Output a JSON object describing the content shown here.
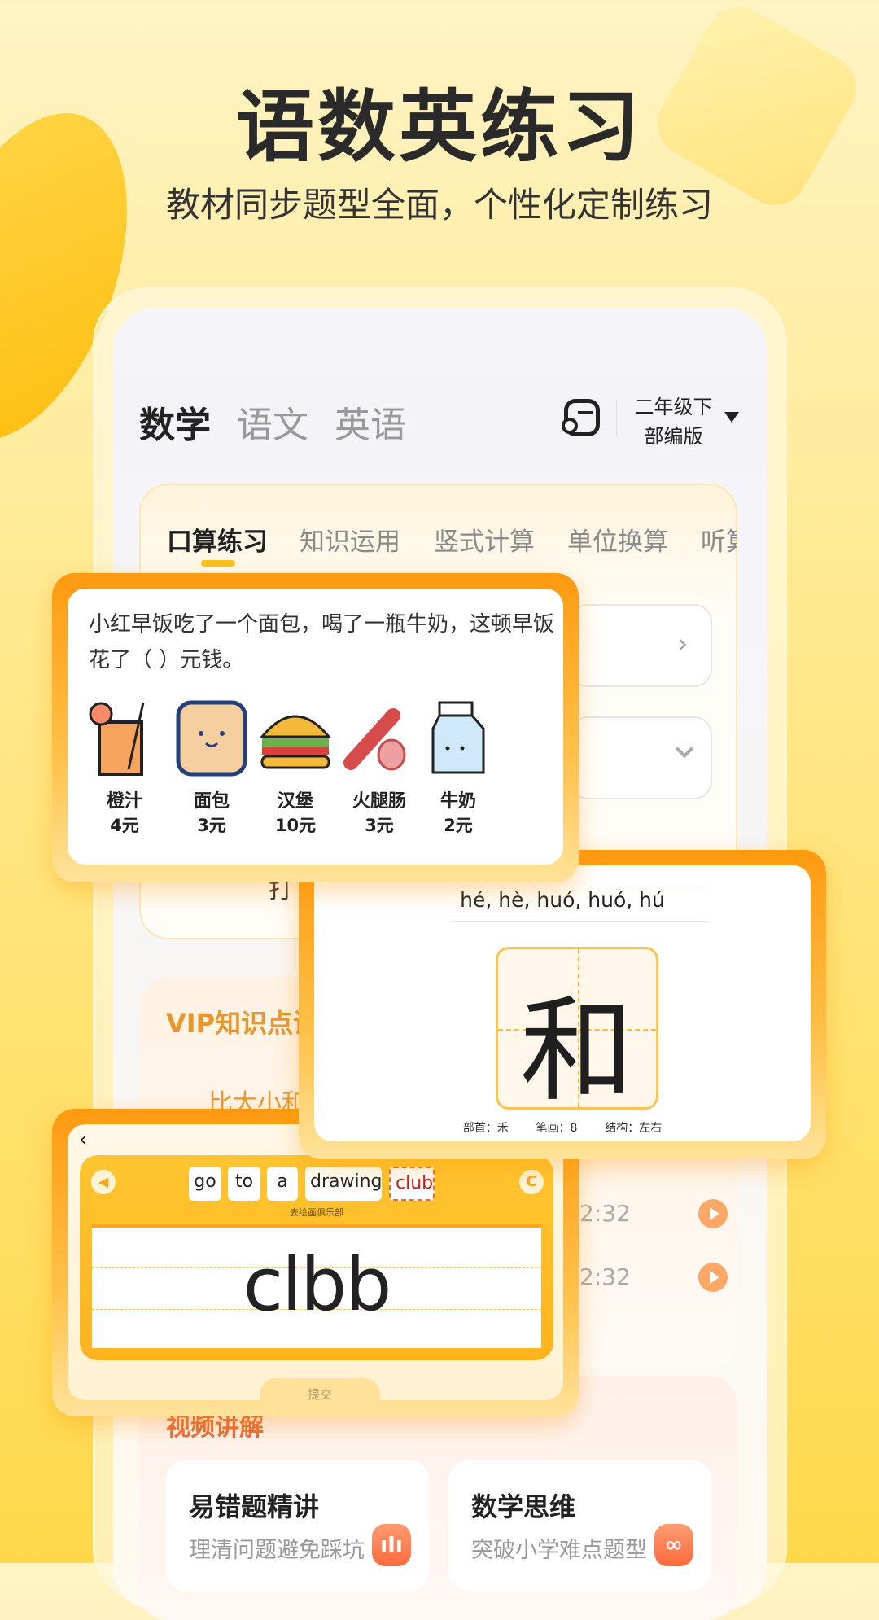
{
  "headline": {
    "title": "语数英练习",
    "subtitle": "教材同步题型全面，个性化定制练习"
  },
  "app": {
    "subjects": [
      {
        "label": "数学",
        "active": true
      },
      {
        "label": "语文",
        "active": false
      },
      {
        "label": "英语",
        "active": false
      }
    ],
    "grade": {
      "line1": "二年级下",
      "line2": "部编版"
    },
    "practice_tabs": [
      {
        "label": "口算练习",
        "active": true
      },
      {
        "label": "知识运用"
      },
      {
        "label": "竖式计算"
      },
      {
        "label": "单位换算"
      },
      {
        "label": "听算"
      }
    ],
    "partial_text": "打",
    "vip": {
      "title": "VIP知识点讲",
      "item": "比大小和",
      "times": [
        "2:32",
        "2:32"
      ]
    },
    "video": {
      "title": "视频讲解",
      "cards": [
        {
          "title": "易错题精讲",
          "subtitle": "理清问题避免踩坑",
          "icon": "audio-wave-icon"
        },
        {
          "title": "数学思维",
          "subtitle": "突破小学难点题型",
          "icon": "infinity-icon"
        }
      ]
    }
  },
  "question_card": {
    "text": "小红早饭吃了一个面包，喝了一瓶牛奶，这顿早饭花了（ ）元钱。",
    "items": [
      {
        "name": "橙汁",
        "price": "4元",
        "icon": "orange-juice-icon"
      },
      {
        "name": "面包",
        "price": "3元",
        "icon": "bread-icon"
      },
      {
        "name": "汉堡",
        "price": "10元",
        "icon": "burger-icon"
      },
      {
        "name": "火腿肠",
        "price": "3元",
        "icon": "sausage-icon"
      },
      {
        "name": "牛奶",
        "price": "2元",
        "icon": "milk-icon"
      }
    ]
  },
  "hanzi_card": {
    "pinyin": "hé, hè, huó, huó, hú",
    "character": "和",
    "radical": "部首：禾",
    "strokes": "笔画：8",
    "structure": "结构：左右"
  },
  "english_card": {
    "words": [
      {
        "text": "go",
        "correct": true
      },
      {
        "text": "to",
        "correct": true
      },
      {
        "text": "a",
        "correct": true
      },
      {
        "text": "drawing",
        "correct": true
      },
      {
        "text": "club",
        "correct": false
      }
    ],
    "translation": "去绘画俱乐部",
    "handwriting": "clbb",
    "submit_label": "提交"
  },
  "colors": {
    "accent": "#ffa51a",
    "vip": "#e8972e",
    "video": "#e86b3a"
  }
}
